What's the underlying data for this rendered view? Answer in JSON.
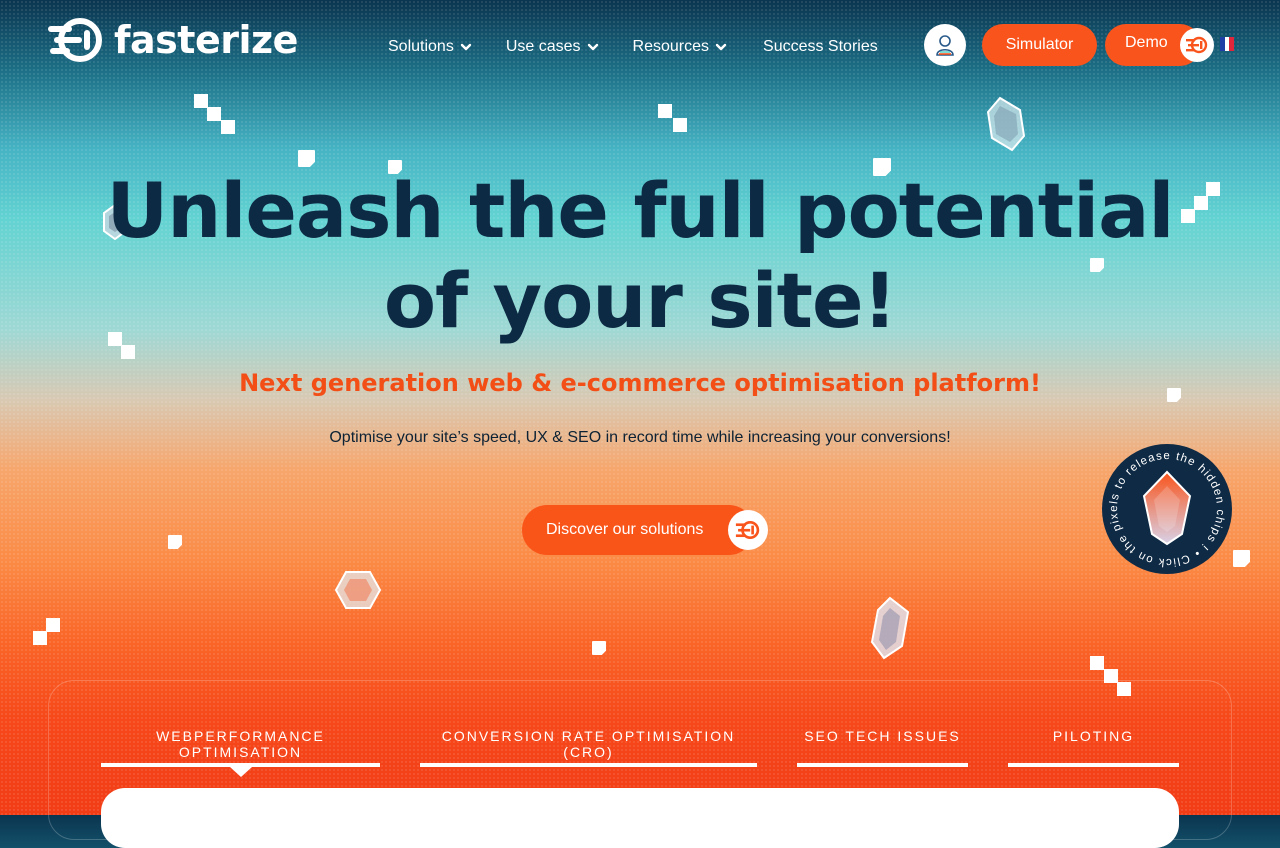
{
  "brand": {
    "name": "fasterize"
  },
  "nav": {
    "items": [
      {
        "label": "Solutions",
        "icon": "chevron-down-icon"
      },
      {
        "label": "Use cases",
        "icon": "chevron-down-icon"
      },
      {
        "label": "Resources",
        "icon": "chevron-down-icon"
      },
      {
        "label": "Success Stories"
      }
    ],
    "account_icon": "user-icon",
    "simulator_label": "Simulator",
    "demo_label": "Demo",
    "language_flag": "france-flag-icon"
  },
  "hero": {
    "title_line1": "Unleash the full potential",
    "title_line2": "of your site!",
    "subtitle": "Next generation web & e-commerce optimisation platform!",
    "description": "Optimise your site’s speed, UX & SEO in record time while increasing your conversions!",
    "cta_label": "Discover our solutions"
  },
  "chips_badge": {
    "text": "Click on the pixels to release the hidden chips ! • "
  },
  "tabs": [
    {
      "label": "WEBPERFORMANCE OPTIMISATION",
      "active": true
    },
    {
      "label": "CONVERSION RATE OPTIMISATION (CRO)",
      "active": false
    },
    {
      "label": "SEO TECH ISSUES",
      "active": false
    },
    {
      "label": "PILOTING",
      "active": false
    }
  ],
  "colors": {
    "accent": "#f9541c",
    "navy": "#0d2a44",
    "subtitle_orange": "#f24e16"
  }
}
